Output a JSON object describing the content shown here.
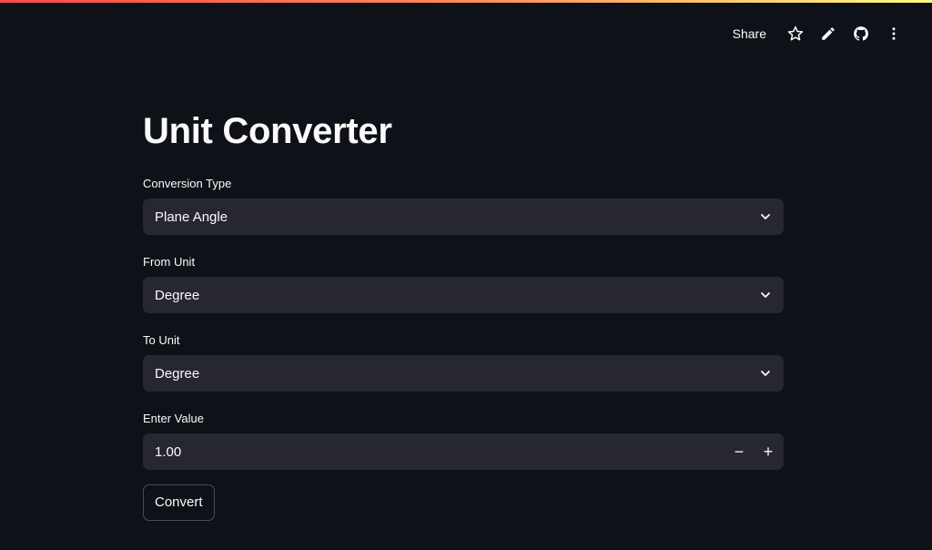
{
  "header": {
    "share_label": "Share",
    "icons": [
      "star-icon",
      "pencil-icon",
      "github-icon",
      "more-vertical-icon"
    ]
  },
  "page": {
    "title": "Unit Converter"
  },
  "form": {
    "conversion_type": {
      "label": "Conversion Type",
      "value": "Plane Angle"
    },
    "from_unit": {
      "label": "From Unit",
      "value": "Degree"
    },
    "to_unit": {
      "label": "To Unit",
      "value": "Degree"
    },
    "enter_value": {
      "label": "Enter Value",
      "value": "1.00",
      "decrement": "−",
      "increment": "+"
    },
    "convert_label": "Convert"
  },
  "colors": {
    "background": "#0e1117",
    "input_bg": "#262730",
    "text": "#fafafa",
    "accent_gradient": [
      "#ff4b4b",
      "#fffd80"
    ]
  }
}
